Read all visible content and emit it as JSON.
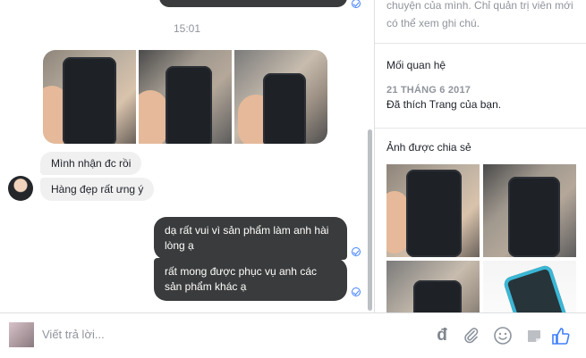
{
  "chat": {
    "time_divider": "15:01",
    "incoming": [
      "Mình nhận đc rồi",
      "Hàng đẹp rất ưng ý"
    ],
    "outgoing": [
      "dạ rất vui vì sản phẩm làm anh hài lòng ạ",
      "rất mong được phục vụ anh các sản phẩm khác ạ"
    ]
  },
  "panel": {
    "note_text": "chuyện của mình. Chỉ quản trị viên mới có thể xem ghi chú.",
    "relationship_title": "Mối quan hệ",
    "relationship_date": "21 THÁNG 6 2017",
    "relationship_text": "Đã thích Trang của bạn.",
    "shared_photos_title": "Ảnh được chia sẻ"
  },
  "composer": {
    "placeholder": "Viết trả lời...",
    "currency_symbol": "đ",
    "icons": [
      "paperclip-icon",
      "emoji-icon",
      "sticker-icon",
      "like-icon"
    ]
  },
  "colors": {
    "accent": "#4080ff",
    "outgoing_bubble": "#3a3b3c",
    "incoming_bubble": "#f1f0f0",
    "muted_text": "#90949c"
  }
}
